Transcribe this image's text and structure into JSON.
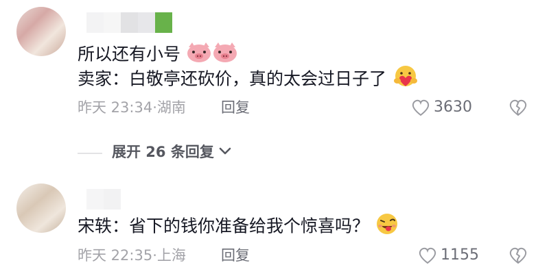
{
  "comments": [
    {
      "text_line1": "所以还有小号",
      "text_line2": "卖家：白敬亭还砍价，真的太会过日子了",
      "time": "昨天 23:34·湖南",
      "reply": "回复",
      "likes": "3630",
      "icons": [
        "pig-emoji",
        "pig-emoji",
        "hug-heart-emoji",
        "heart-icon",
        "broken-heart-icon"
      ]
    },
    {
      "text": "宋轶：省下的钱你准备给我个惊喜吗？",
      "time": "昨天 22:35·上海",
      "reply": "回复",
      "likes": "1155",
      "icons": [
        "wink-tongue-emoji",
        "heart-icon",
        "broken-heart-icon"
      ]
    }
  ],
  "expand_replies": "展开 26 条回复",
  "colors": {
    "text": "#161823",
    "meta": "#a3a3a8",
    "secondary": "#6b6d76"
  }
}
